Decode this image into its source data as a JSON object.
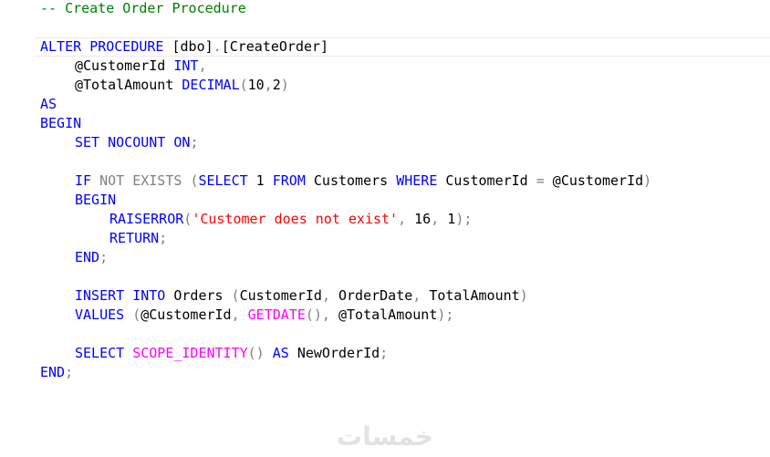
{
  "editor": {
    "lines": [
      {
        "indent": 1,
        "tokens": [
          {
            "t": "-- Create Order Procedure",
            "c": "cm"
          }
        ]
      },
      {
        "indent": 0,
        "tokens": []
      },
      {
        "indent": 1,
        "tokens": [
          {
            "t": "ALTER",
            "c": "kw"
          },
          {
            "t": " ",
            "c": "id"
          },
          {
            "t": "PROCEDURE",
            "c": "kw"
          },
          {
            "t": " ",
            "c": "id"
          },
          {
            "t": "[dbo]",
            "c": "id"
          },
          {
            "t": ".",
            "c": "op"
          },
          {
            "t": "[CreateOrder]",
            "c": "id"
          }
        ]
      },
      {
        "indent": 2,
        "tokens": [
          {
            "t": "@CustomerId",
            "c": "id"
          },
          {
            "t": " ",
            "c": "id"
          },
          {
            "t": "INT",
            "c": "kw"
          },
          {
            "t": ",",
            "c": "op"
          }
        ]
      },
      {
        "indent": 2,
        "tokens": [
          {
            "t": "@TotalAmount",
            "c": "id"
          },
          {
            "t": " ",
            "c": "id"
          },
          {
            "t": "DECIMAL",
            "c": "kw"
          },
          {
            "t": "(",
            "c": "op"
          },
          {
            "t": "10",
            "c": "num"
          },
          {
            "t": ",",
            "c": "op"
          },
          {
            "t": "2",
            "c": "num"
          },
          {
            "t": ")",
            "c": "op"
          }
        ]
      },
      {
        "indent": 1,
        "tokens": [
          {
            "t": "AS",
            "c": "kw"
          }
        ]
      },
      {
        "indent": 1,
        "tokens": [
          {
            "t": "BEGIN",
            "c": "kw"
          }
        ]
      },
      {
        "indent": 2,
        "tokens": [
          {
            "t": "SET",
            "c": "kw"
          },
          {
            "t": " ",
            "c": "id"
          },
          {
            "t": "NOCOUNT",
            "c": "kw"
          },
          {
            "t": " ",
            "c": "id"
          },
          {
            "t": "ON",
            "c": "kw"
          },
          {
            "t": ";",
            "c": "op"
          }
        ]
      },
      {
        "indent": 0,
        "tokens": []
      },
      {
        "indent": 2,
        "tokens": [
          {
            "t": "IF",
            "c": "kw"
          },
          {
            "t": " ",
            "c": "id"
          },
          {
            "t": "NOT",
            "c": "op"
          },
          {
            "t": " ",
            "c": "id"
          },
          {
            "t": "EXISTS",
            "c": "op"
          },
          {
            "t": " ",
            "c": "id"
          },
          {
            "t": "(",
            "c": "op"
          },
          {
            "t": "SELECT",
            "c": "kw"
          },
          {
            "t": " 1 ",
            "c": "num"
          },
          {
            "t": "FROM",
            "c": "kw"
          },
          {
            "t": " Customers ",
            "c": "id"
          },
          {
            "t": "WHERE",
            "c": "kw"
          },
          {
            "t": " CustomerId ",
            "c": "id"
          },
          {
            "t": "=",
            "c": "op"
          },
          {
            "t": " @CustomerId",
            "c": "id"
          },
          {
            "t": ")",
            "c": "op"
          }
        ]
      },
      {
        "indent": 2,
        "tokens": [
          {
            "t": "BEGIN",
            "c": "kw"
          }
        ]
      },
      {
        "indent": 3,
        "tokens": [
          {
            "t": "RAISERROR",
            "c": "kw"
          },
          {
            "t": "(",
            "c": "op"
          },
          {
            "t": "'Customer does not exist'",
            "c": "str"
          },
          {
            "t": ",",
            "c": "op"
          },
          {
            "t": " 16",
            "c": "num"
          },
          {
            "t": ",",
            "c": "op"
          },
          {
            "t": " 1",
            "c": "num"
          },
          {
            "t": ");",
            "c": "op"
          }
        ]
      },
      {
        "indent": 3,
        "tokens": [
          {
            "t": "RETURN",
            "c": "kw"
          },
          {
            "t": ";",
            "c": "op"
          }
        ]
      },
      {
        "indent": 2,
        "tokens": [
          {
            "t": "END",
            "c": "kw"
          },
          {
            "t": ";",
            "c": "op"
          }
        ]
      },
      {
        "indent": 0,
        "tokens": []
      },
      {
        "indent": 2,
        "tokens": [
          {
            "t": "INSERT",
            "c": "kw"
          },
          {
            "t": " ",
            "c": "id"
          },
          {
            "t": "INTO",
            "c": "kw"
          },
          {
            "t": " Orders ",
            "c": "id"
          },
          {
            "t": "(",
            "c": "op"
          },
          {
            "t": "CustomerId",
            "c": "id"
          },
          {
            "t": ",",
            "c": "op"
          },
          {
            "t": " OrderDate",
            "c": "id"
          },
          {
            "t": ",",
            "c": "op"
          },
          {
            "t": " TotalAmount",
            "c": "id"
          },
          {
            "t": ")",
            "c": "op"
          }
        ]
      },
      {
        "indent": 2,
        "tokens": [
          {
            "t": "VALUES",
            "c": "kw"
          },
          {
            "t": " ",
            "c": "id"
          },
          {
            "t": "(",
            "c": "op"
          },
          {
            "t": "@CustomerId",
            "c": "id"
          },
          {
            "t": ",",
            "c": "op"
          },
          {
            "t": " ",
            "c": "id"
          },
          {
            "t": "GETDATE",
            "c": "fn"
          },
          {
            "t": "(),",
            "c": "op"
          },
          {
            "t": " @TotalAmount",
            "c": "id"
          },
          {
            "t": ");",
            "c": "op"
          }
        ]
      },
      {
        "indent": 0,
        "tokens": []
      },
      {
        "indent": 2,
        "tokens": [
          {
            "t": "SELECT",
            "c": "kw"
          },
          {
            "t": " ",
            "c": "id"
          },
          {
            "t": "SCOPE_IDENTITY",
            "c": "fn"
          },
          {
            "t": "()",
            "c": "op"
          },
          {
            "t": " ",
            "c": "id"
          },
          {
            "t": "AS",
            "c": "kw"
          },
          {
            "t": " NewOrderId",
            "c": "id"
          },
          {
            "t": ";",
            "c": "op"
          }
        ]
      },
      {
        "indent": 1,
        "tokens": [
          {
            "t": "END",
            "c": "kw"
          },
          {
            "t": ";",
            "c": "op"
          }
        ]
      }
    ]
  },
  "watermark": {
    "text": "خمسات"
  }
}
